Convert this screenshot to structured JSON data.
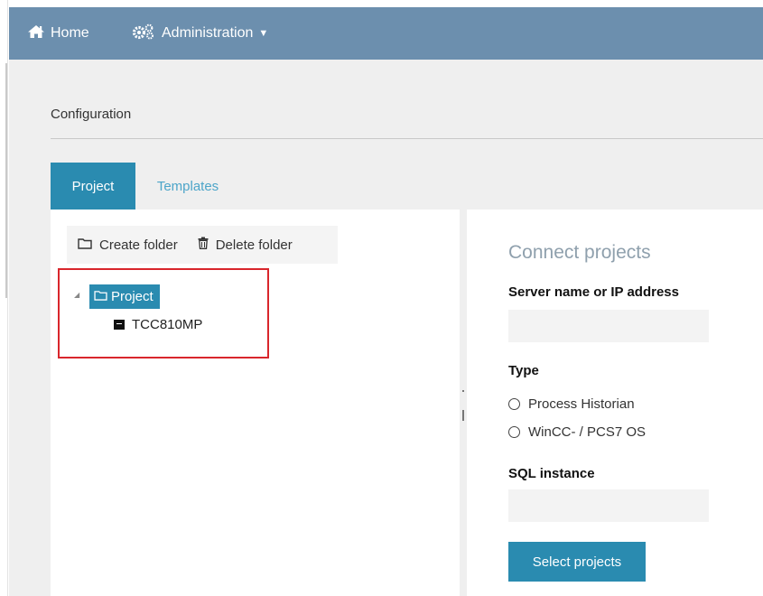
{
  "navbar": {
    "home_label": "Home",
    "admin_label": "Administration",
    "icons": {
      "home": "home-icon",
      "admin": "cogs-icon",
      "caret": "caret-down-icon"
    },
    "background": "#6c8fae"
  },
  "page": {
    "title": "Configuration"
  },
  "tabs": [
    {
      "label": "Project",
      "active": true
    },
    {
      "label": "Templates",
      "active": false
    }
  ],
  "toolbar": {
    "create_folder_label": "Create folder",
    "delete_folder_label": "Delete folder",
    "icons": {
      "create": "folder-icon",
      "delete": "trash-icon"
    }
  },
  "tree": {
    "root": {
      "label": "Project",
      "expanded": true,
      "selected": true,
      "icon": "folder-icon"
    },
    "children": [
      {
        "label": "TCC810MP",
        "icon": "project-box-icon"
      }
    ]
  },
  "connect": {
    "title": "Connect projects",
    "server_label": "Server name or IP address",
    "server_value": "",
    "type_label": "Type",
    "type_options": [
      "Process Historian",
      "WinCC- / PCS7 OS"
    ],
    "sql_label": "SQL instance",
    "sql_value": "",
    "select_button": "Select projects"
  },
  "colors": {
    "accent": "#2a8bb0",
    "highlight_border": "#d9262c"
  }
}
